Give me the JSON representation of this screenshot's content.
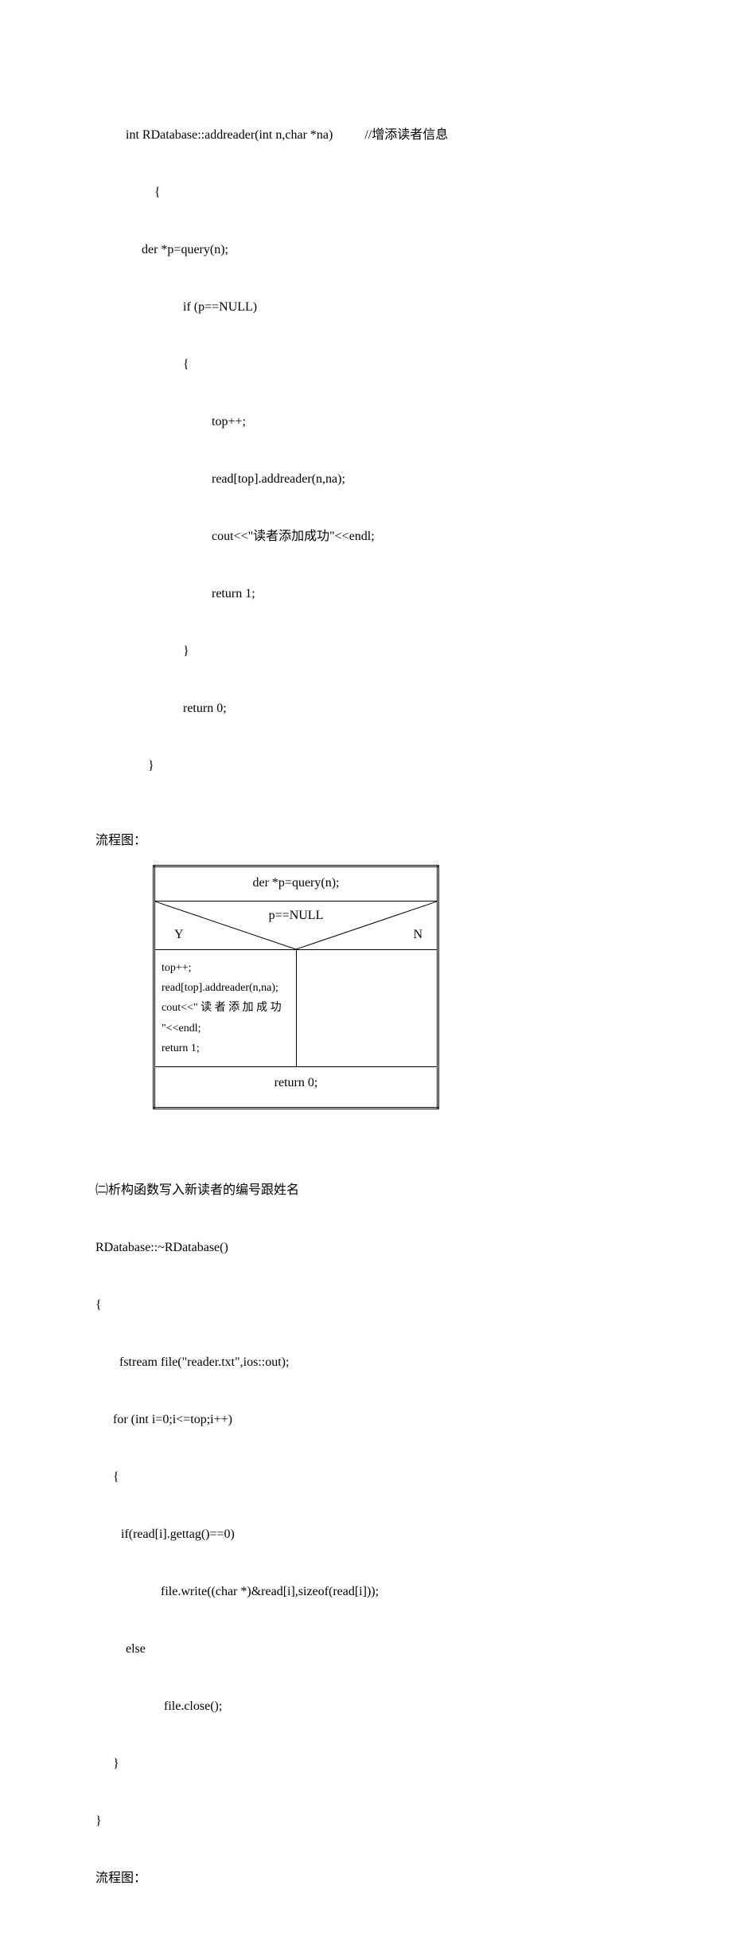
{
  "code1": {
    "signature_left": "int RDatabase::addreader(int n,char *na)",
    "signature_comment": "//增添读者信息",
    "lines": {
      "brace_open": "  {",
      "der": "der *p=query(n);",
      "if": "if (p==NULL)",
      "if_open": "{",
      "top": "top++;",
      "read": "read[top].addreader(n,na);",
      "cout": "cout<<\"读者添加成功\"<<endl;",
      "ret1": "return 1;",
      "if_close": "}",
      "ret0": "return 0;",
      "brace_close": "}"
    }
  },
  "labels": {
    "flow": "流程图："
  },
  "chart_data": {
    "type": "table",
    "purpose": "NS flowchart for addreader",
    "header": "der *p=query(n);",
    "condition": "p==NULL",
    "branch_yes_label": "Y",
    "branch_no_label": "N",
    "yes_lines": [
      "top++;",
      "read[top].addreader(n,na);",
      "cout<<\" 读 者 添 加 成 功",
      "\"<<endl;",
      "return 1;"
    ],
    "footer": "return 0;"
  },
  "section2": {
    "title": "㈡析构函数写入新读者的编号跟姓名",
    "code": {
      "sig": "RDatabase::~RDatabase()",
      "open": "{",
      "fstream": "fstream file(\"reader.txt\",ios::out);",
      "for": "for (int i=0;i<=top;i++)",
      "for_open": "{",
      "if": "if(read[i].gettag()==0)",
      "write": "file.write((char *)&read[i],sizeof(read[i]));",
      "else": "else",
      "close_file": "file.close();",
      "for_close": "}",
      "close": "}"
    },
    "flow_label": "流程图："
  }
}
